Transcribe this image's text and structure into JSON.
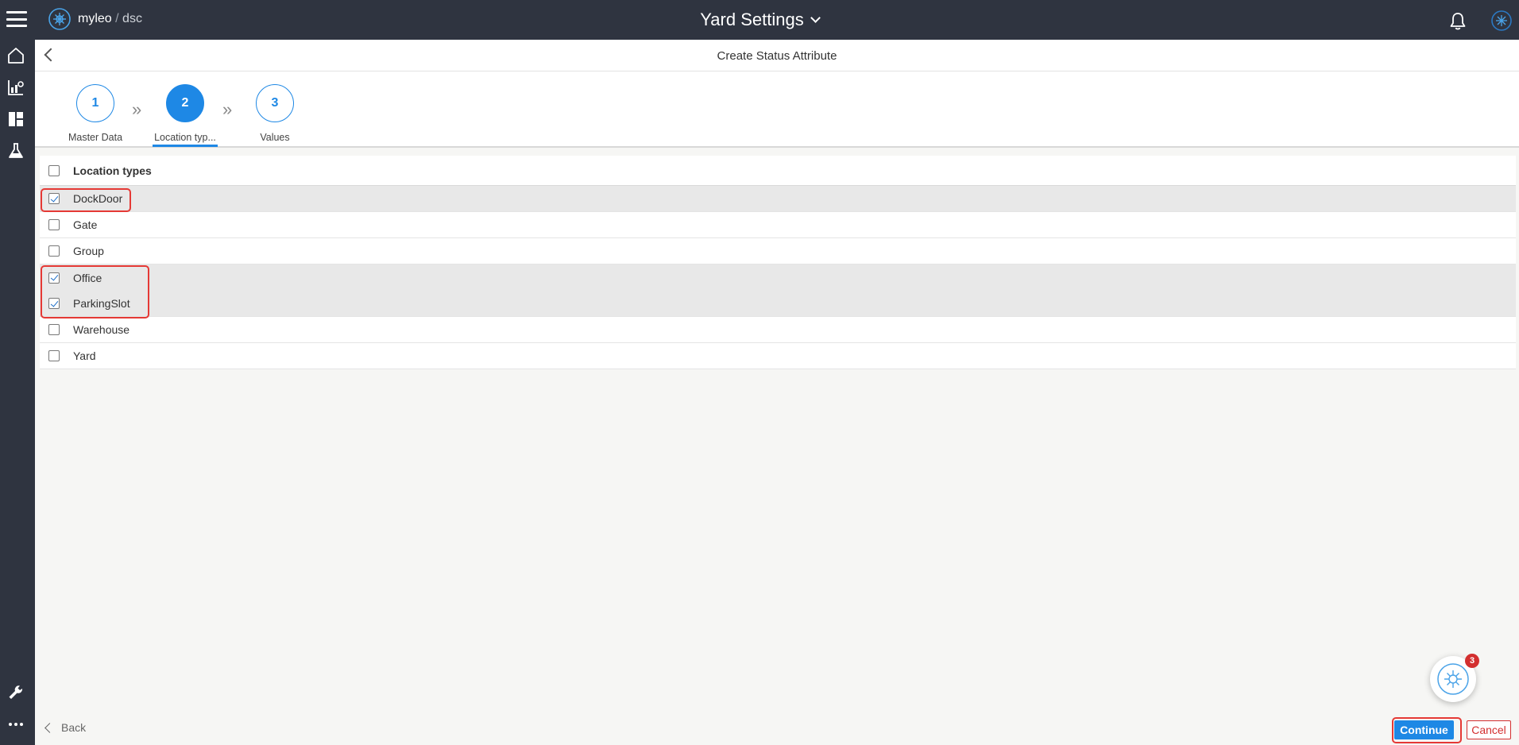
{
  "app": {
    "logo_name": "myleo",
    "logo_separator": "/",
    "logo_suffix": "dsc",
    "title": "Yard Settings"
  },
  "colors": {
    "topbar": "#2f3440",
    "accent": "#1e88e5",
    "highlight": "#e53935",
    "cancel": "#d32f2f"
  },
  "nav": {
    "icons": [
      "home-icon",
      "analytics-icon",
      "dashboard-icon",
      "lab-flask-icon",
      "wrench-icon",
      "more-icon"
    ]
  },
  "page": {
    "title": "Create Status Attribute"
  },
  "stepper": {
    "steps": [
      {
        "number": "1",
        "label": "Master Data",
        "active": false
      },
      {
        "number": "2",
        "label": "Location typ...",
        "active": true
      },
      {
        "number": "3",
        "label": "Values",
        "active": false
      }
    ]
  },
  "table": {
    "header": "Location types",
    "rows": [
      {
        "label": "DockDoor",
        "checked": true
      },
      {
        "label": "Gate",
        "checked": false
      },
      {
        "label": "Group",
        "checked": false
      },
      {
        "label": "Office",
        "checked": true
      },
      {
        "label": "ParkingSlot",
        "checked": true
      },
      {
        "label": "Warehouse",
        "checked": false
      },
      {
        "label": "Yard",
        "checked": false
      }
    ]
  },
  "assistant": {
    "badge_count": "3"
  },
  "footer": {
    "back_label": "Back",
    "continue_label": "Continue",
    "cancel_label": "Cancel"
  }
}
